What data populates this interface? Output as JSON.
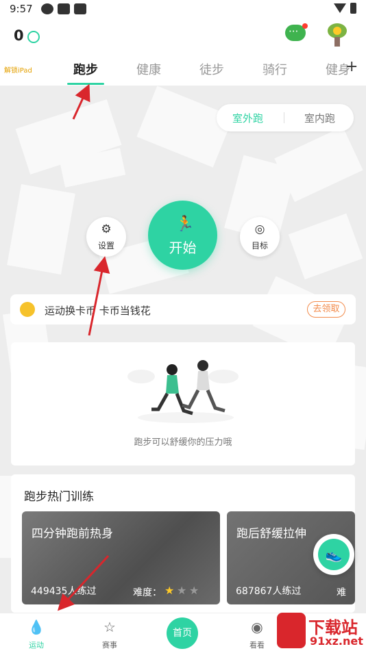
{
  "status_bar": {
    "time": "9:57"
  },
  "top": {
    "coins": "0"
  },
  "tabs": {
    "promo": "解锁iPad",
    "items": [
      "跑步",
      "健康",
      "徒步",
      "骑行",
      "健身"
    ],
    "add": "+"
  },
  "mode": {
    "outdoor": "室外跑",
    "indoor": "室内跑"
  },
  "controls": {
    "settings": "设置",
    "start": "开始",
    "goal": "目标"
  },
  "promo_bar": {
    "text": "运动换卡币 卡币当钱花",
    "button": "去领取"
  },
  "empty_state": {
    "text": "跑步可以舒缓你的压力哦"
  },
  "hot_training": {
    "title": "跑步热门训练",
    "cards": [
      {
        "title": "四分钟跑前热身",
        "count": "449435人练过",
        "difficulty": "难度：",
        "stars_filled": 1,
        "stars_total": 3
      },
      {
        "title": "跑后舒缓拉伸",
        "count": "687867人练过",
        "difficulty": "难"
      }
    ]
  },
  "bottom_nav": {
    "items": [
      {
        "label": "运动",
        "icon": "droplet-icon"
      },
      {
        "label": "赛事",
        "icon": "badge-icon"
      },
      {
        "label": "首页",
        "icon": "home-button"
      },
      {
        "label": "看看",
        "icon": "view-icon"
      }
    ]
  },
  "watermark": {
    "text": "下载站",
    "url": "91xz.net"
  },
  "colors": {
    "accent": "#2ed3a3",
    "promo": "#f28a4a",
    "annotation": "#d9262c"
  }
}
